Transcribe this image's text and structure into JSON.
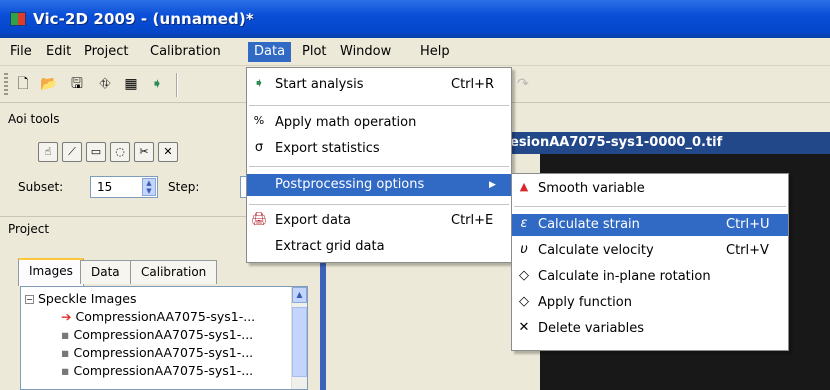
{
  "window": {
    "title": "Vic-2D 2009 - (unnamed)*"
  },
  "menubar": [
    "File",
    "Edit",
    "Project",
    "Calibration",
    "Data",
    "Plot",
    "Window",
    "Help"
  ],
  "left_panel": {
    "aoi_title": "Aoi tools",
    "subset_label": "Subset:",
    "subset_value": "15",
    "step_label": "Step:",
    "project_title": "Project",
    "tabs": [
      "Images",
      "Data",
      "Calibration"
    ],
    "tree": {
      "root": "Speckle Images",
      "items": [
        "CompressionAA7075-sys1-...",
        "CompressionAA7075-sys1-...",
        "CompressionAA7075-sys1-...",
        "CompressionAA7075-sys1-..."
      ]
    }
  },
  "image_title": "esionAA7075-sys1-0000_0.tif",
  "data_menu": {
    "items": [
      {
        "label": "Start analysis",
        "shortcut": "Ctrl+R",
        "icon": "start-analysis-icon"
      },
      {
        "label": "Apply math operation",
        "icon": "percent-icon"
      },
      {
        "label": "Export statistics",
        "icon": "sigma-icon"
      },
      {
        "label": "Postprocessing options",
        "icon": "none"
      },
      {
        "label": "Export data",
        "shortcut": "Ctrl+E",
        "icon": "export-data-icon"
      },
      {
        "label": "Extract grid data"
      }
    ]
  },
  "postprocessing_menu": {
    "items": [
      {
        "label": "Smooth variable",
        "icon": "triangle-icon"
      },
      {
        "label": "Calculate strain",
        "shortcut": "Ctrl+U",
        "icon": "epsilon-icon"
      },
      {
        "label": "Calculate velocity",
        "shortcut": "Ctrl+V",
        "icon": "upsilon-icon"
      },
      {
        "label": "Calculate in-plane rotation",
        "icon": "diamond-icon"
      },
      {
        "label": "Apply function",
        "icon": "diamond-icon"
      },
      {
        "label": "Delete variables",
        "icon": "x-icon"
      }
    ]
  },
  "colors": {
    "menu_highlight": "#316ac5",
    "titlebar": "#0546c9"
  }
}
